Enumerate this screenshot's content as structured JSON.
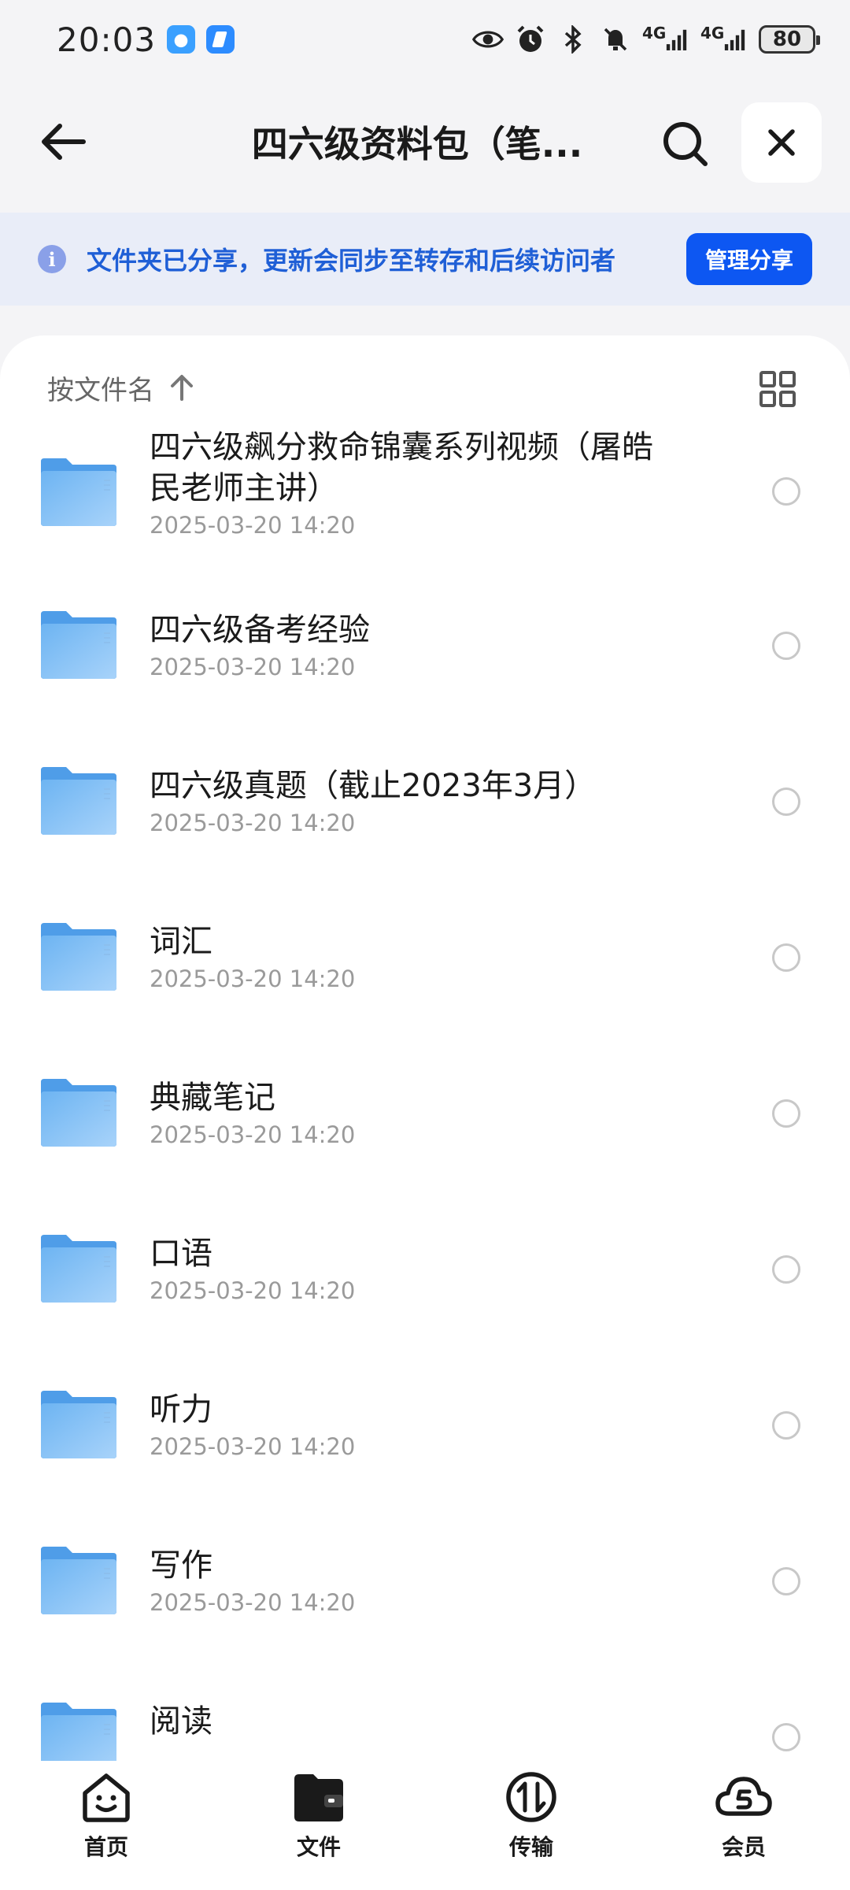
{
  "status_bar": {
    "time": "20:03",
    "network_1": "4G",
    "network_2": "4G",
    "battery": "80",
    "icons": [
      "eye-icon",
      "alarm-icon",
      "bluetooth-icon",
      "mute-icon",
      "signal-icon",
      "signal-icon"
    ]
  },
  "header": {
    "title": "四六级资料包（笔...",
    "back_icon": "arrow-left-icon",
    "search_icon": "search-icon",
    "close_icon": "close-icon"
  },
  "share_banner": {
    "text": "文件夹已分享，更新会同步至转存和后续访问者",
    "button_label": "管理分享",
    "icon": "info-icon",
    "info_glyph": "i"
  },
  "sort": {
    "label": "按文件名",
    "arrow_icon": "arrow-up-icon",
    "view_icon": "grid-view-icon"
  },
  "files": [
    {
      "name": "四六级飙分救命锦囊系列视频（屠皓民老师主讲）",
      "name_line1": "四六级飙分救命锦囊系列视频（屠皓",
      "name_line2": "民老师主讲）",
      "date": "2025-03-20 14:20"
    },
    {
      "name": "四六级备考经验",
      "date": "2025-03-20 14:20"
    },
    {
      "name": "四六级真题（截止2023年3月）",
      "date": "2025-03-20 14:20"
    },
    {
      "name": "词汇",
      "date": "2025-03-20 14:20"
    },
    {
      "name": "典藏笔记",
      "date": "2025-03-20 14:20"
    },
    {
      "name": "口语",
      "date": "2025-03-20 14:20"
    },
    {
      "name": "听力",
      "date": "2025-03-20 14:20"
    },
    {
      "name": "写作",
      "date": "2025-03-20 14:20"
    },
    {
      "name": "阅读",
      "date": ""
    }
  ],
  "bottom_nav": [
    {
      "label": "首页",
      "icon": "home-smile-icon"
    },
    {
      "label": "文件",
      "icon": "folder-wallet-icon",
      "active": true
    },
    {
      "label": "传输",
      "icon": "transfer-icon"
    },
    {
      "label": "会员",
      "icon": "cloud-member-icon"
    }
  ],
  "colors": {
    "accent": "#0d57f2",
    "banner_bg": "#e9edf8",
    "banner_text": "#1f5fd6",
    "folder": "#5aaaf0",
    "page_bg": "#f4f4f6"
  }
}
